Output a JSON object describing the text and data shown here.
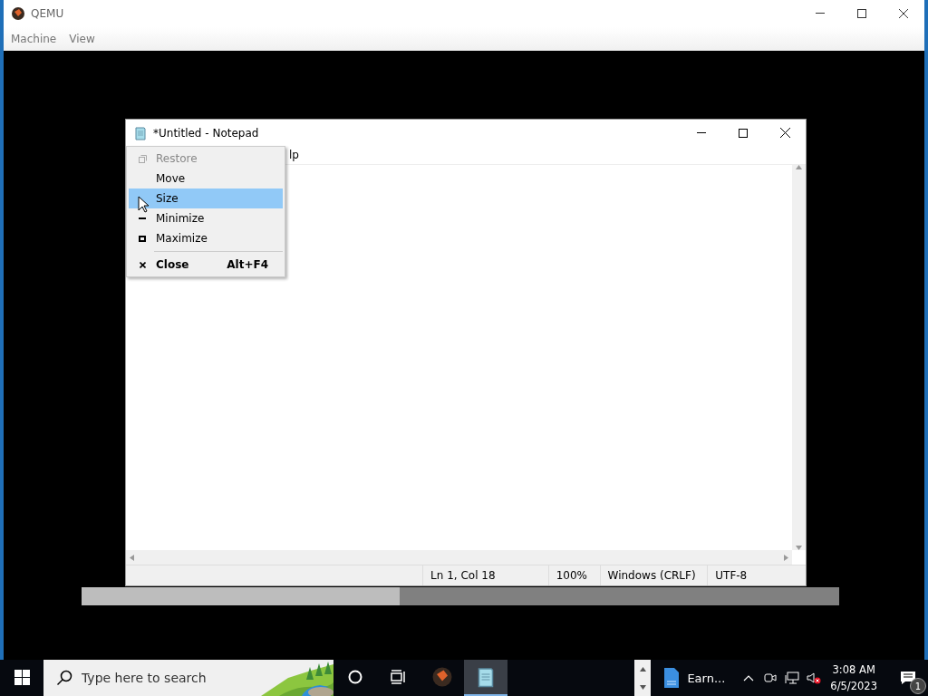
{
  "host_window": {
    "title": "QEMU",
    "menu": [
      "Machine",
      "View"
    ]
  },
  "notepad": {
    "title": "*Untitled - Notepad",
    "menu_fragment": "lp",
    "status_bar": [
      "Ln 1, Col 18",
      "100%",
      "Windows (CRLF)",
      "UTF-8"
    ]
  },
  "system_menu": {
    "items": [
      {
        "kind": "restore",
        "label": "Restore",
        "disabled": true,
        "selected": false
      },
      {
        "kind": "move",
        "label": "Move",
        "disabled": false,
        "selected": false
      },
      {
        "kind": "size",
        "label": "Size",
        "disabled": false,
        "selected": true
      },
      {
        "kind": "minimize",
        "label": "Minimize",
        "disabled": false,
        "selected": false
      },
      {
        "kind": "maximize",
        "label": "Maximize",
        "disabled": false,
        "selected": false
      },
      {
        "kind": "close",
        "label": "Close",
        "shortcut": "Alt+F4",
        "disabled": false,
        "selected": false
      }
    ]
  },
  "progress": {
    "level": 0.42
  },
  "taskbar": {
    "search": {
      "placeholder": "Type here to search"
    },
    "apps": [
      {
        "kind": "qemu",
        "selected": false
      },
      {
        "kind": "notepad",
        "selected": true
      }
    ],
    "document": {
      "label": "Earn..."
    },
    "clock": {
      "time": "3:08 AM",
      "date": "6/5/2023"
    },
    "notification_count": "1"
  }
}
